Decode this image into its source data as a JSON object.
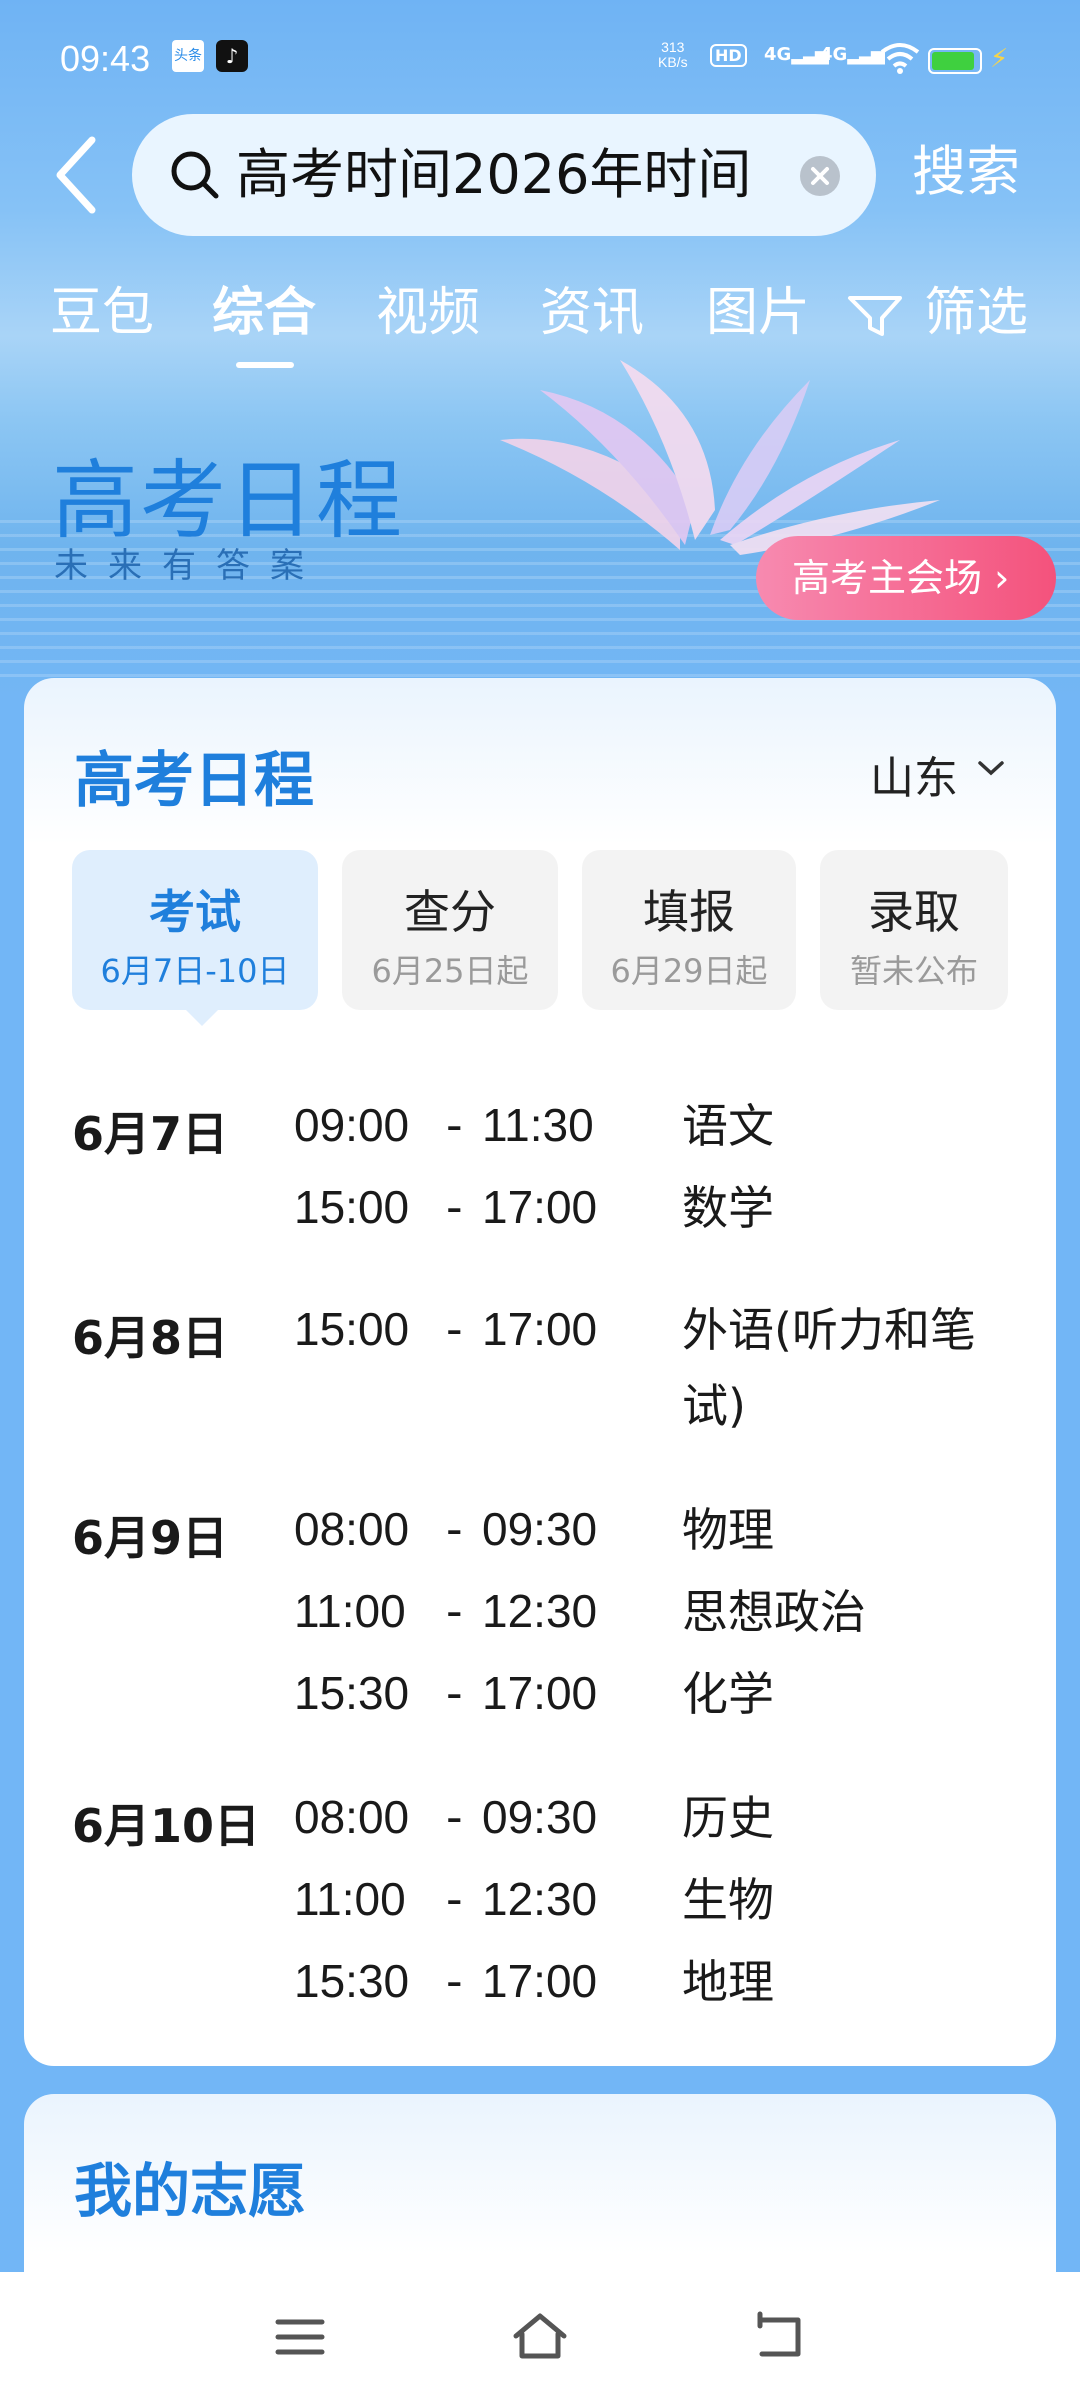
{
  "status_bar": {
    "time": "09:43",
    "app1": "头条",
    "app2": "♪",
    "speed_value": "313",
    "speed_unit": "KB/s",
    "hd": "HD",
    "net1": "4G",
    "net2": "4G"
  },
  "search": {
    "query": "高考时间2026年时间",
    "button": "搜索"
  },
  "tabs": [
    "豆包",
    "综合",
    "视频",
    "资讯",
    "图片",
    "筛选"
  ],
  "banner": {
    "title": "高考日程",
    "subtitle": "未来有答案",
    "venue_button": "高考主会场"
  },
  "schedule": {
    "title": "高考日程",
    "province": "山东",
    "stages": [
      {
        "name": "考试",
        "date": "6月7日-10日"
      },
      {
        "name": "查分",
        "date": "6月25日起"
      },
      {
        "name": "填报",
        "date": "6月29日起"
      },
      {
        "name": "录取",
        "date": "暂未公布"
      }
    ],
    "days": [
      {
        "date": "6月7日",
        "slots": [
          {
            "start": "09:00",
            "end": "11:30",
            "subject": "语文"
          },
          {
            "start": "15:00",
            "end": "17:00",
            "subject": "数学"
          }
        ]
      },
      {
        "date": "6月8日",
        "slots": [
          {
            "start": "15:00",
            "end": "17:00",
            "subject": "外语(听力和笔试)"
          }
        ]
      },
      {
        "date": "6月9日",
        "slots": [
          {
            "start": "08:00",
            "end": "09:30",
            "subject": "物理"
          },
          {
            "start": "11:00",
            "end": "12:30",
            "subject": "思想政治"
          },
          {
            "start": "15:30",
            "end": "17:00",
            "subject": "化学"
          }
        ]
      },
      {
        "date": "6月10日",
        "slots": [
          {
            "start": "08:00",
            "end": "09:30",
            "subject": "历史"
          },
          {
            "start": "11:00",
            "end": "12:30",
            "subject": "生物"
          },
          {
            "start": "15:30",
            "end": "17:00",
            "subject": "地理"
          }
        ]
      }
    ],
    "dash": "-"
  },
  "wishes": {
    "title": "我的志愿"
  },
  "colors": {
    "accent": "#1f7fdc",
    "background": "#72b6f6",
    "venue_button": "#f4527c"
  }
}
